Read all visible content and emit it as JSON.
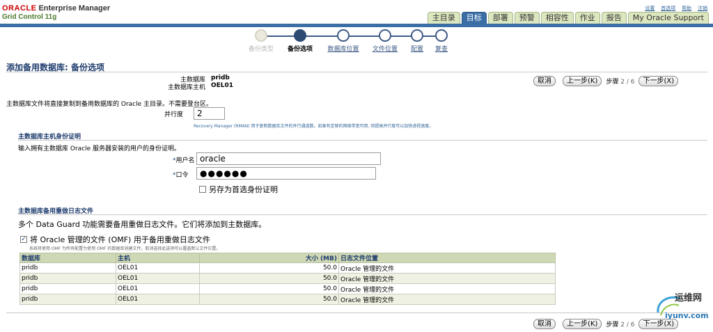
{
  "header": {
    "brand_oracle": "ORACLE",
    "brand_em": "Enterprise Manager",
    "subtitle": "Grid Control 11g",
    "global_links": [
      "设置",
      "首选项",
      "帮助",
      "注销"
    ],
    "tabs": [
      "主目录",
      "目标",
      "部署",
      "预警",
      "相容性",
      "作业",
      "报告",
      "My Oracle Support"
    ],
    "active_tab": "目标",
    "bar_color": "#3a6ea5"
  },
  "train": {
    "steps": [
      "备份类型",
      "备份选项",
      "数据库位置",
      "文件位置",
      "配置",
      "复查"
    ],
    "current_index": 1
  },
  "page": {
    "title": "添加备用数据库: 备份选项",
    "primary_db_label": "主数据库",
    "primary_db_value": "pridb",
    "primary_host_label": "主数据库主机",
    "primary_host_value": "OEL01"
  },
  "nav": {
    "cancel": "取消",
    "back": "上一步(K)",
    "step_label": "步骤",
    "step_value": "2 / 6",
    "next": "下一步(X)"
  },
  "backup": {
    "note": "主数据库文件将直接复制到备用数据库的 Oracle 主目录。不需要登台区。",
    "parallel_label": "并行度",
    "parallel_value": "2",
    "parallel_hint": "Recovery Manager (RMAN) 用于复制数据库文件的并行通道数。如果有足够的网络带宽可用, 则提高并行度可以加快进程速度。"
  },
  "credentials": {
    "section_title": "主数据库主机身份证明",
    "desc": "输入拥有主数据库 Oracle 服务器安装的用户的身份证明。",
    "username_label": "用户名",
    "username_value": "oracle",
    "password_label": "口令",
    "password_value": "●●●●●●",
    "save_pref_label": "另存为首选身份证明"
  },
  "redo": {
    "section_title": "主数据库备用重做日志文件",
    "desc": "多个 Data Guard 功能需要备用重做日志文件。它们将添加到主数据库。",
    "omf_label": "将 Oracle 管理的文件 (OMF) 用于备用重做日志文件",
    "omf_hint": "系统将使用 OMF 为所有配置为使用 OMF 的数据库创建文件。取消选择此选项可以覆盖默认文件位置。",
    "columns": [
      "数据库",
      "主机",
      "大小 (MB)",
      "日志文件位置"
    ],
    "rows": [
      [
        "pridb",
        "OEL01",
        "50.0",
        "Oracle 管理的文件"
      ],
      [
        "pridb",
        "OEL01",
        "50.0",
        "Oracle 管理的文件"
      ],
      [
        "pridb",
        "OEL01",
        "50.0",
        "Oracle 管理的文件"
      ],
      [
        "pridb",
        "OEL01",
        "50.0",
        "Oracle 管理的文件"
      ]
    ]
  },
  "watermark": {
    "name": "运维网",
    "url": "iyunv.com"
  }
}
